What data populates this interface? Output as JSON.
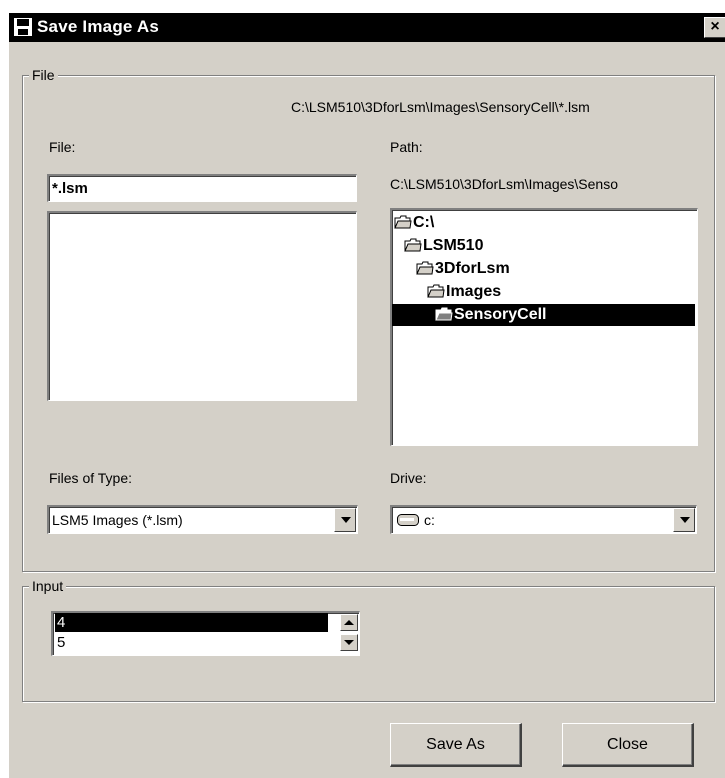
{
  "window": {
    "title": "Save Image As",
    "close_glyph": "×"
  },
  "file_group": {
    "legend": "File",
    "full_path": "C:\\LSM510\\3DforLsm\\Images\\SensoryCell\\*.lsm",
    "file_label": "File:",
    "file_value": "*.lsm",
    "path_label": "Path:",
    "path_value": "C:\\LSM510\\3DforLsm\\Images\\Senso",
    "folders": [
      {
        "label": "C:\\"
      },
      {
        "label": "LSM510"
      },
      {
        "label": "3DforLsm"
      },
      {
        "label": "Images"
      },
      {
        "label": "SensoryCell",
        "selected": true
      }
    ],
    "files_of_type_label": "Files of Type:",
    "files_of_type_value": "LSM5 Images (*.lsm)",
    "drive_label": "Drive:",
    "drive_value": "c:"
  },
  "input_group": {
    "legend": "Input",
    "options": [
      "4",
      "5"
    ]
  },
  "buttons": {
    "save_as": "Save As",
    "close": "Close"
  },
  "icons": {
    "app": "save-disk-icon",
    "folder": "open-folder-icon",
    "drive": "hard-drive-icon"
  }
}
